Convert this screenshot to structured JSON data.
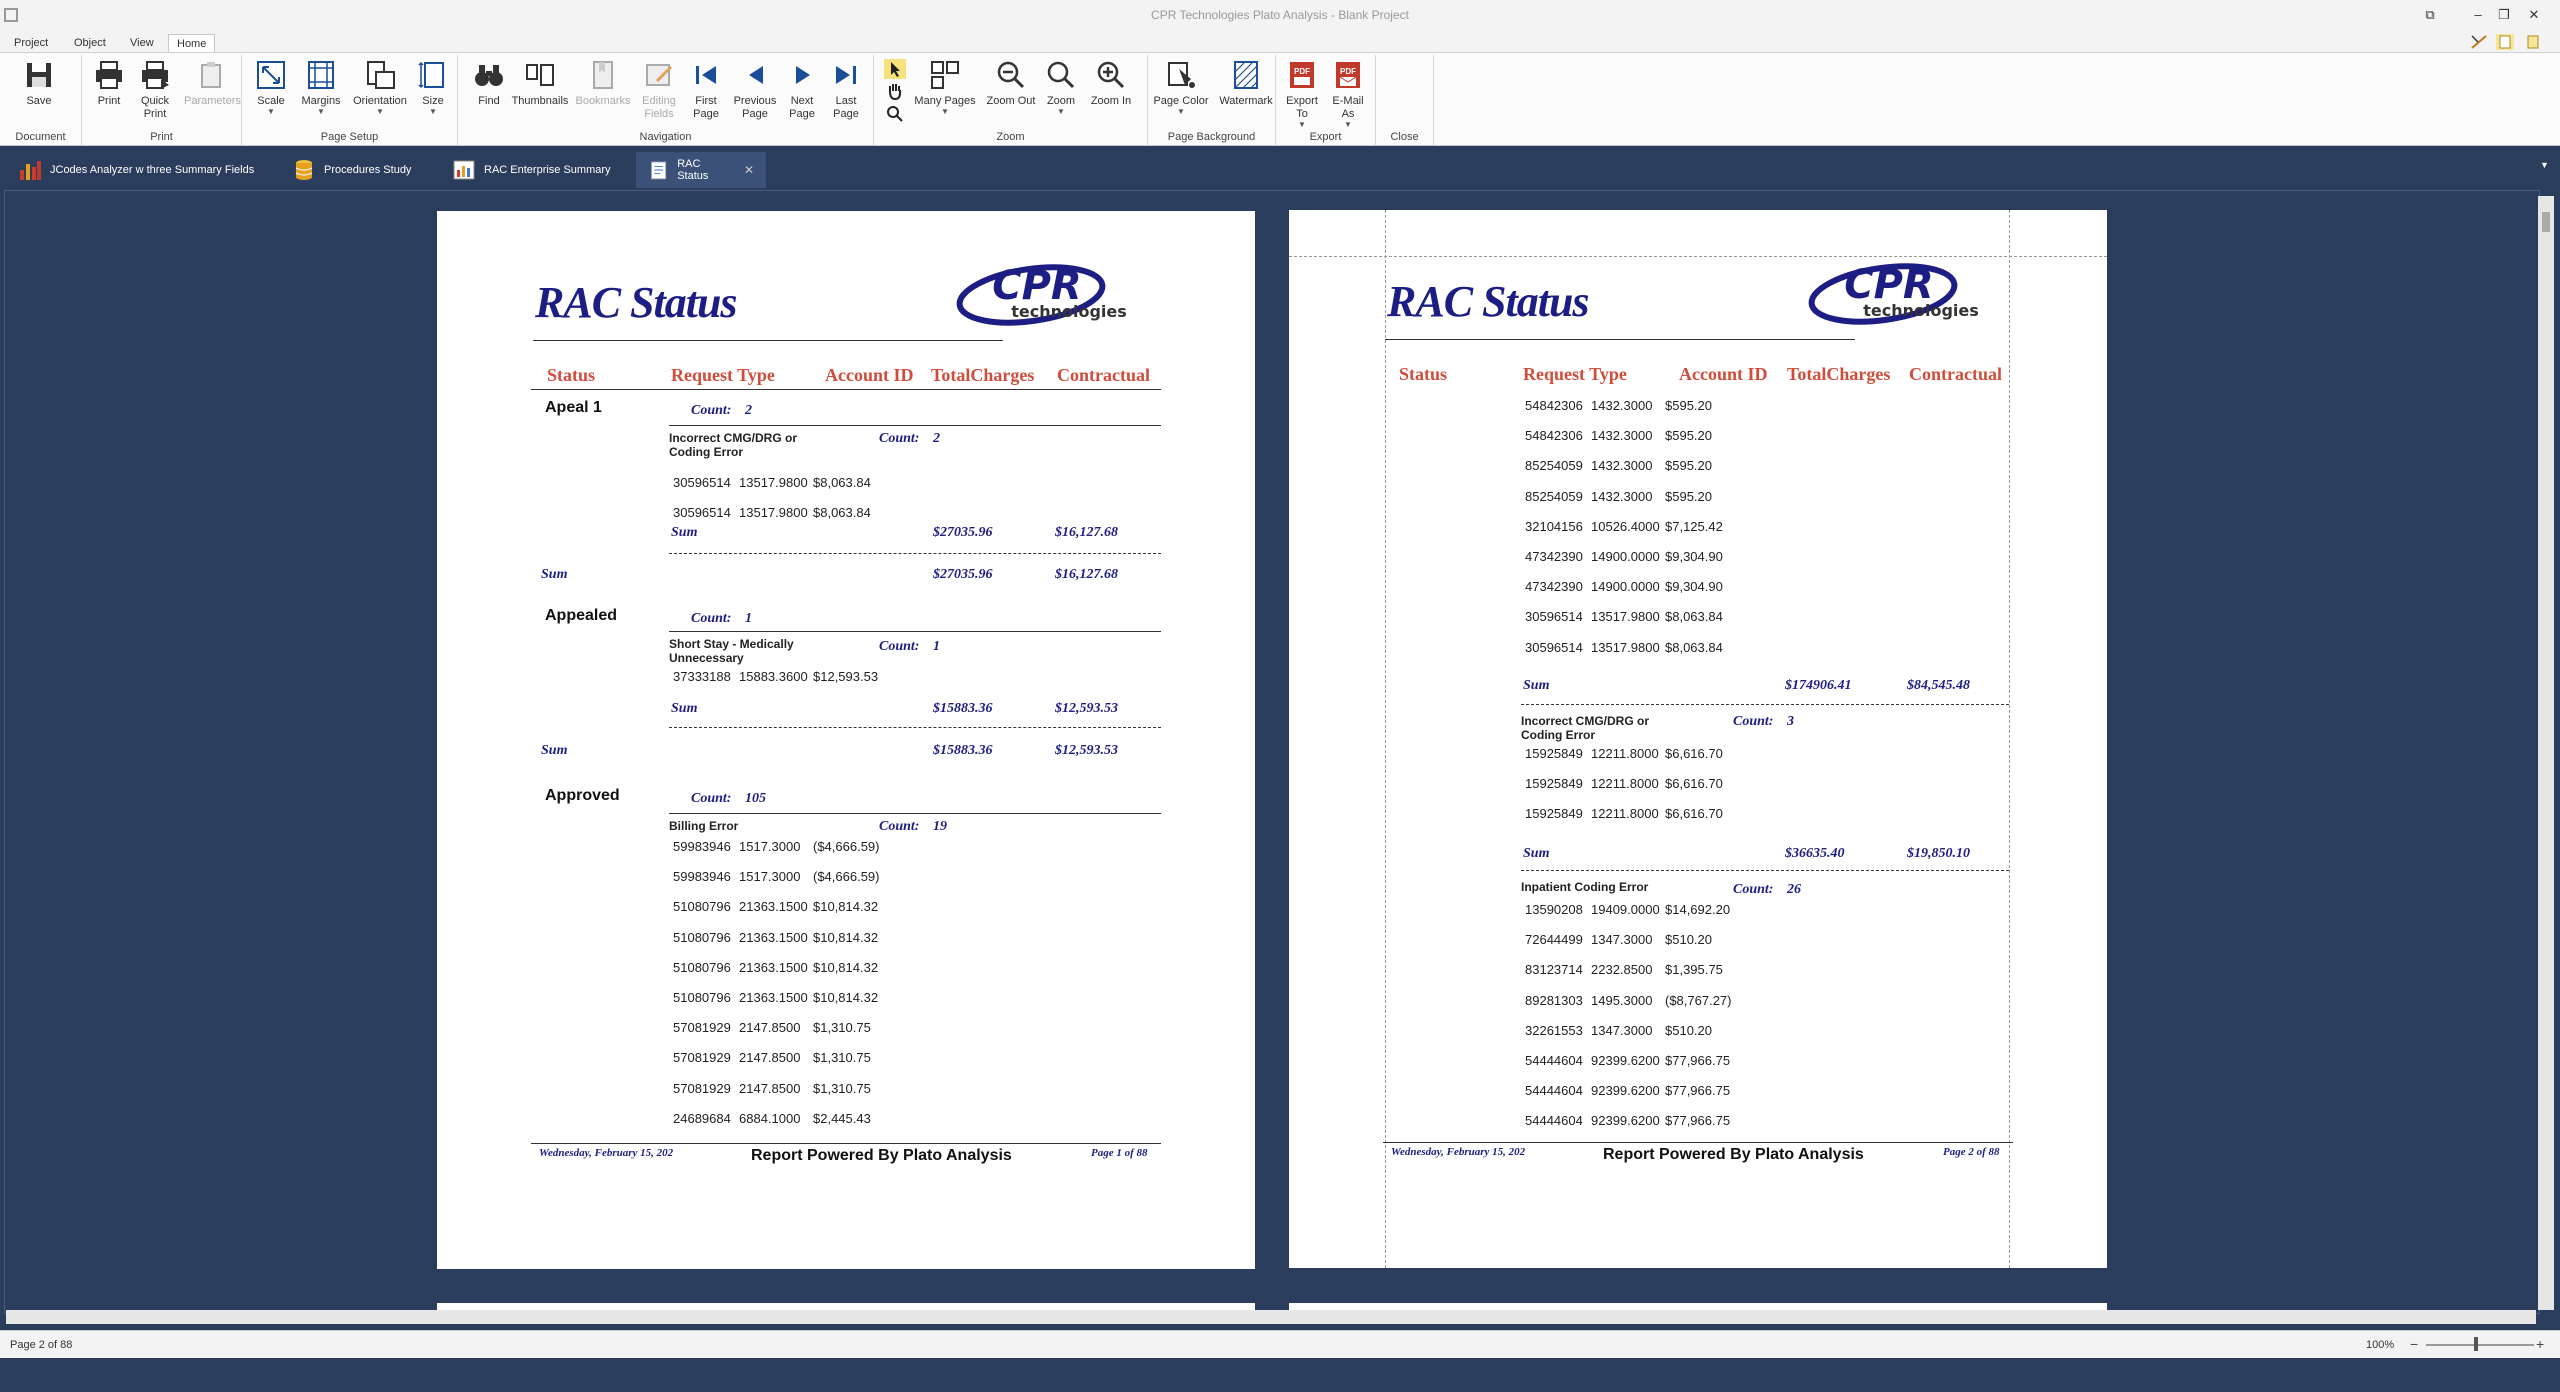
{
  "window": {
    "title": "CPR Technologies Plato Analysis - Blank Project"
  },
  "menu_tabs": [
    "Project",
    "Object",
    "View",
    "Home"
  ],
  "ribbon": {
    "groups": {
      "document": "Document",
      "print": "Print",
      "page_setup": "Page Setup",
      "navigation": "Navigation",
      "zoom": "Zoom",
      "page_background": "Page Background",
      "export": "Export",
      "close": "Close"
    },
    "buttons": {
      "save": "Save",
      "print": "Print",
      "quick_print": "Quick Print",
      "parameters": "Parameters",
      "scale": "Scale",
      "margins": "Margins",
      "orientation": "Orientation",
      "size": "Size",
      "find": "Find",
      "thumbnails": "Thumbnails",
      "bookmarks": "Bookmarks",
      "editing_fields": "Editing Fields",
      "first_page": "First Page",
      "previous_page": "Previous Page",
      "next_page": "Next Page",
      "last_page": "Last Page",
      "many_pages": "Many Pages",
      "zoom_out": "Zoom Out",
      "zoom": "Zoom",
      "zoom_in": "Zoom In",
      "page_color": "Page Color",
      "watermark": "Watermark",
      "export_to": "Export To",
      "email_as": "E-Mail As"
    }
  },
  "doc_tabs": [
    {
      "label": "JCodes Analyzer w three Summary Fields"
    },
    {
      "label": "Procedures Study"
    },
    {
      "label": "RAC Enterprise Summary"
    },
    {
      "label": "RAC Status"
    }
  ],
  "report": {
    "title": "RAC Status",
    "logo_top": "CPR",
    "logo_bottom": "technologies",
    "columns": [
      "Status",
      "Request Type",
      "Account ID",
      "TotalCharges",
      "Contractual"
    ],
    "count_label": "Count:",
    "sum_label": "Sum",
    "footer_date": "Wednesday, February 15, 202",
    "footer_center": "Report Powered By Plato Analysis"
  },
  "page1": {
    "footer_page": "Page 1 of 88",
    "g1": {
      "name": "Apeal 1",
      "count": "2"
    },
    "g1s1": {
      "name_l1": "Incorrect CMG/DRG or",
      "name_l2": "Coding Error",
      "count": "2",
      "sum_total": "$27035.96",
      "sum_contr": "$16,127.68"
    },
    "g1_sum": {
      "total": "$27035.96",
      "contr": "$16,127.68"
    },
    "g1_rows": [
      [
        "30596514",
        "13517.9800",
        "$8,063.84"
      ],
      [
        "30596514",
        "13517.9800",
        "$8,063.84"
      ]
    ],
    "g2": {
      "name": "Appealed",
      "count": "1"
    },
    "g2s1": {
      "name_l1": "Short Stay - Medically",
      "name_l2": "Unnecessary",
      "count": "1",
      "sum_total": "$15883.36",
      "sum_contr": "$12,593.53"
    },
    "g2_sum": {
      "total": "$15883.36",
      "contr": "$12,593.53"
    },
    "g2_rows": [
      [
        "37333188",
        "15883.3600",
        "$12,593.53"
      ]
    ],
    "g3": {
      "name": "Approved",
      "count": "105"
    },
    "g3s1": {
      "name_l1": "Billing Error",
      "count": "19"
    },
    "g3_rows": [
      [
        "59983946",
        "1517.3000",
        "($4,666.59)"
      ],
      [
        "59983946",
        "1517.3000",
        "($4,666.59)"
      ],
      [
        "51080796",
        "21363.1500",
        "$10,814.32"
      ],
      [
        "51080796",
        "21363.1500",
        "$10,814.32"
      ],
      [
        "51080796",
        "21363.1500",
        "$10,814.32"
      ],
      [
        "51080796",
        "21363.1500",
        "$10,814.32"
      ],
      [
        "57081929",
        "2147.8500",
        "$1,310.75"
      ],
      [
        "57081929",
        "2147.8500",
        "$1,310.75"
      ],
      [
        "57081929",
        "2147.8500",
        "$1,310.75"
      ],
      [
        "24689684",
        "6884.1000",
        "$2,445.43"
      ]
    ]
  },
  "page2": {
    "footer_page": "Page 2 of 88",
    "rows_a": [
      [
        "54842306",
        "1432.3000",
        "$595.20"
      ],
      [
        "54842306",
        "1432.3000",
        "$595.20"
      ],
      [
        "85254059",
        "1432.3000",
        "$595.20"
      ],
      [
        "85254059",
        "1432.3000",
        "$595.20"
      ],
      [
        "32104156",
        "10526.4000",
        "$7,125.42"
      ],
      [
        "47342390",
        "14900.0000",
        "$9,304.90"
      ],
      [
        "47342390",
        "14900.0000",
        "$9,304.90"
      ],
      [
        "30596514",
        "13517.9800",
        "$8,063.84"
      ],
      [
        "30596514",
        "13517.9800",
        "$8,063.84"
      ]
    ],
    "sum_a": {
      "total": "$174906.41",
      "contr": "$84,545.48"
    },
    "s2": {
      "name_l1": "Incorrect CMG/DRG or",
      "name_l2": "Coding Error",
      "count": "3"
    },
    "rows_b": [
      [
        "15925849",
        "12211.8000",
        "$6,616.70"
      ],
      [
        "15925849",
        "12211.8000",
        "$6,616.70"
      ],
      [
        "15925849",
        "12211.8000",
        "$6,616.70"
      ]
    ],
    "sum_b": {
      "total": "$36635.40",
      "contr": "$19,850.10"
    },
    "s3": {
      "name_l1": "Inpatient Coding Error",
      "count": "26"
    },
    "rows_c": [
      [
        "13590208",
        "19409.0000",
        "$14,692.20"
      ],
      [
        "72644499",
        "1347.3000",
        "$510.20"
      ],
      [
        "83123714",
        "2232.8500",
        "$1,395.75"
      ],
      [
        "89281303",
        "1495.3000",
        "($8,767.27)"
      ],
      [
        "32261553",
        "1347.3000",
        "$510.20"
      ],
      [
        "54444604",
        "92399.6200",
        "$77,966.75"
      ],
      [
        "54444604",
        "92399.6200",
        "$77,966.75"
      ],
      [
        "54444604",
        "92399.6200",
        "$77,966.75"
      ]
    ]
  },
  "status": {
    "page_info": "Page 2 of 88",
    "zoom": "100%"
  }
}
